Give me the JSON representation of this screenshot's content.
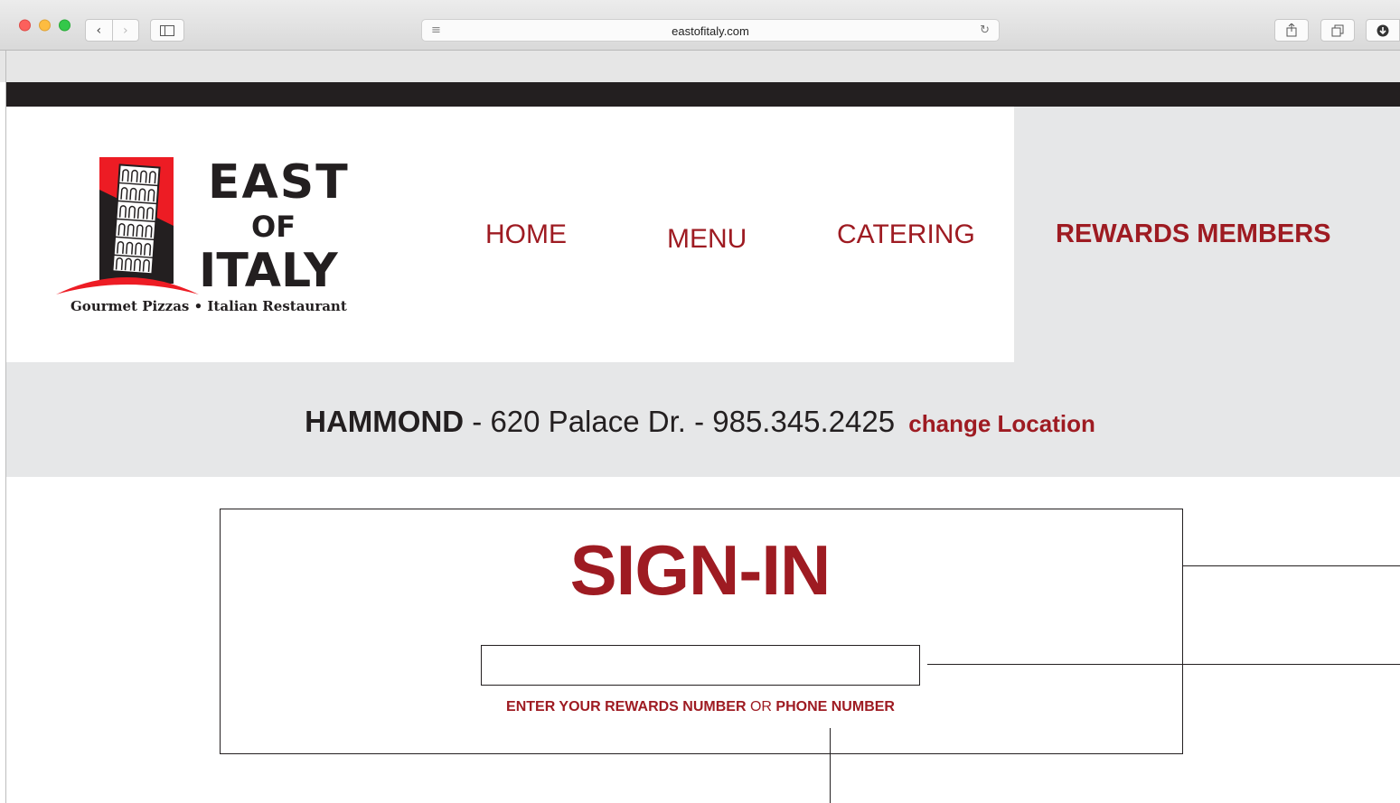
{
  "browser": {
    "url": "eastofitaly.com"
  },
  "logo": {
    "line1": "EAST",
    "line2": "OF",
    "line3": "ITALY",
    "tagline": "Gourmet Pizzas • Italian Restaurant"
  },
  "nav": {
    "home": "HOME",
    "menu": "MENU",
    "catering": "CATERING",
    "rewards": "REWARDS MEMBERS"
  },
  "location": {
    "city": "HAMMOND",
    "details": " - 620 Palace Dr. - 985.345.2425 ",
    "change": "change Location"
  },
  "signin": {
    "title": "SIGN-IN",
    "input_value": "",
    "hint_part1": "ENTER YOUR REWARDS NUMBER",
    "hint_or": " OR ",
    "hint_part2": "PHONE NUMBER"
  },
  "colors": {
    "brand_red": "#9e1b22",
    "dark": "#231f20",
    "light_gray": "#e6e7e8"
  }
}
